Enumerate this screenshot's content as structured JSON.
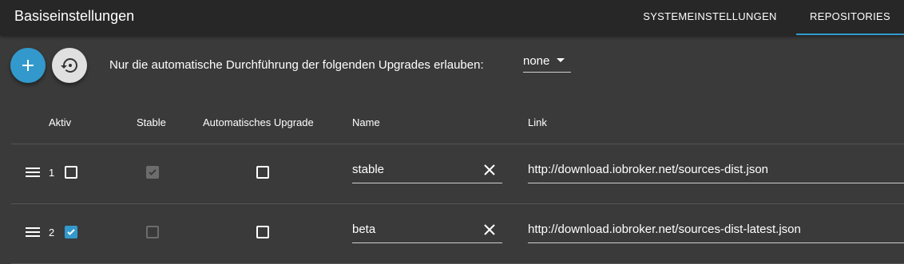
{
  "header": {
    "title": "Basiseinstellungen",
    "tabs": [
      {
        "label": "SYSTEMEINSTELLUNGEN",
        "active": false
      },
      {
        "label": "REPOSITORIES",
        "active": true
      }
    ]
  },
  "toolbar": {
    "add_icon": "plus-icon",
    "restore_icon": "restore-icon",
    "upgrade_label": "Nur die automatische Durchführung der folgenden Upgrades erlauben:",
    "upgrade_value": "none"
  },
  "table": {
    "columns": [
      "Aktiv",
      "Stable",
      "Automatisches Upgrade",
      "Name",
      "Link"
    ],
    "rows": [
      {
        "index": "1",
        "active": false,
        "stable": true,
        "auto_upgrade": false,
        "name": "stable",
        "link": "http://download.iobroker.net/sources-dist.json"
      },
      {
        "index": "2",
        "active": true,
        "stable": false,
        "auto_upgrade": false,
        "name": "beta",
        "link": "http://download.iobroker.net/sources-dist-latest.json"
      }
    ]
  },
  "colors": {
    "accent": "#3399cc",
    "appbar": "#272727",
    "background": "#3a3a3a"
  }
}
